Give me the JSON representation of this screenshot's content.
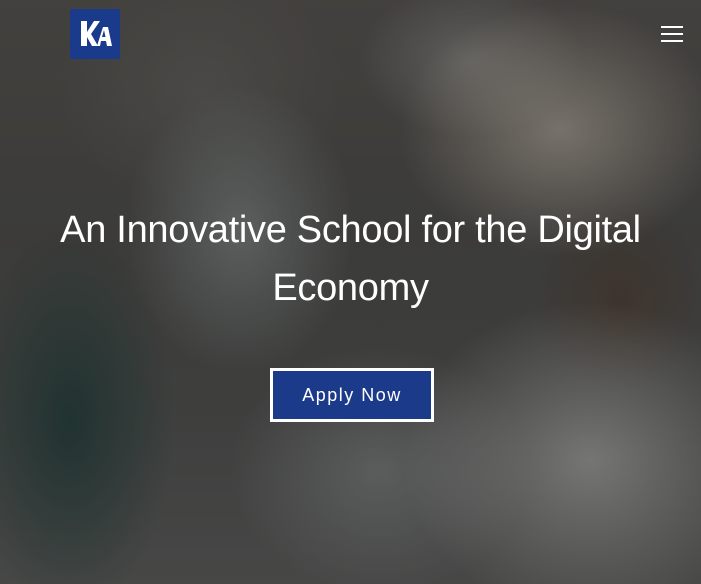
{
  "header": {
    "logo_text": "KA",
    "logo_color": "#1a3a8c",
    "menu_icon": "hamburger-menu-icon"
  },
  "hero": {
    "headline": "An Innovative School for the Digital Economy",
    "cta_label": "Apply Now",
    "cta_color": "#1c3a8a"
  }
}
